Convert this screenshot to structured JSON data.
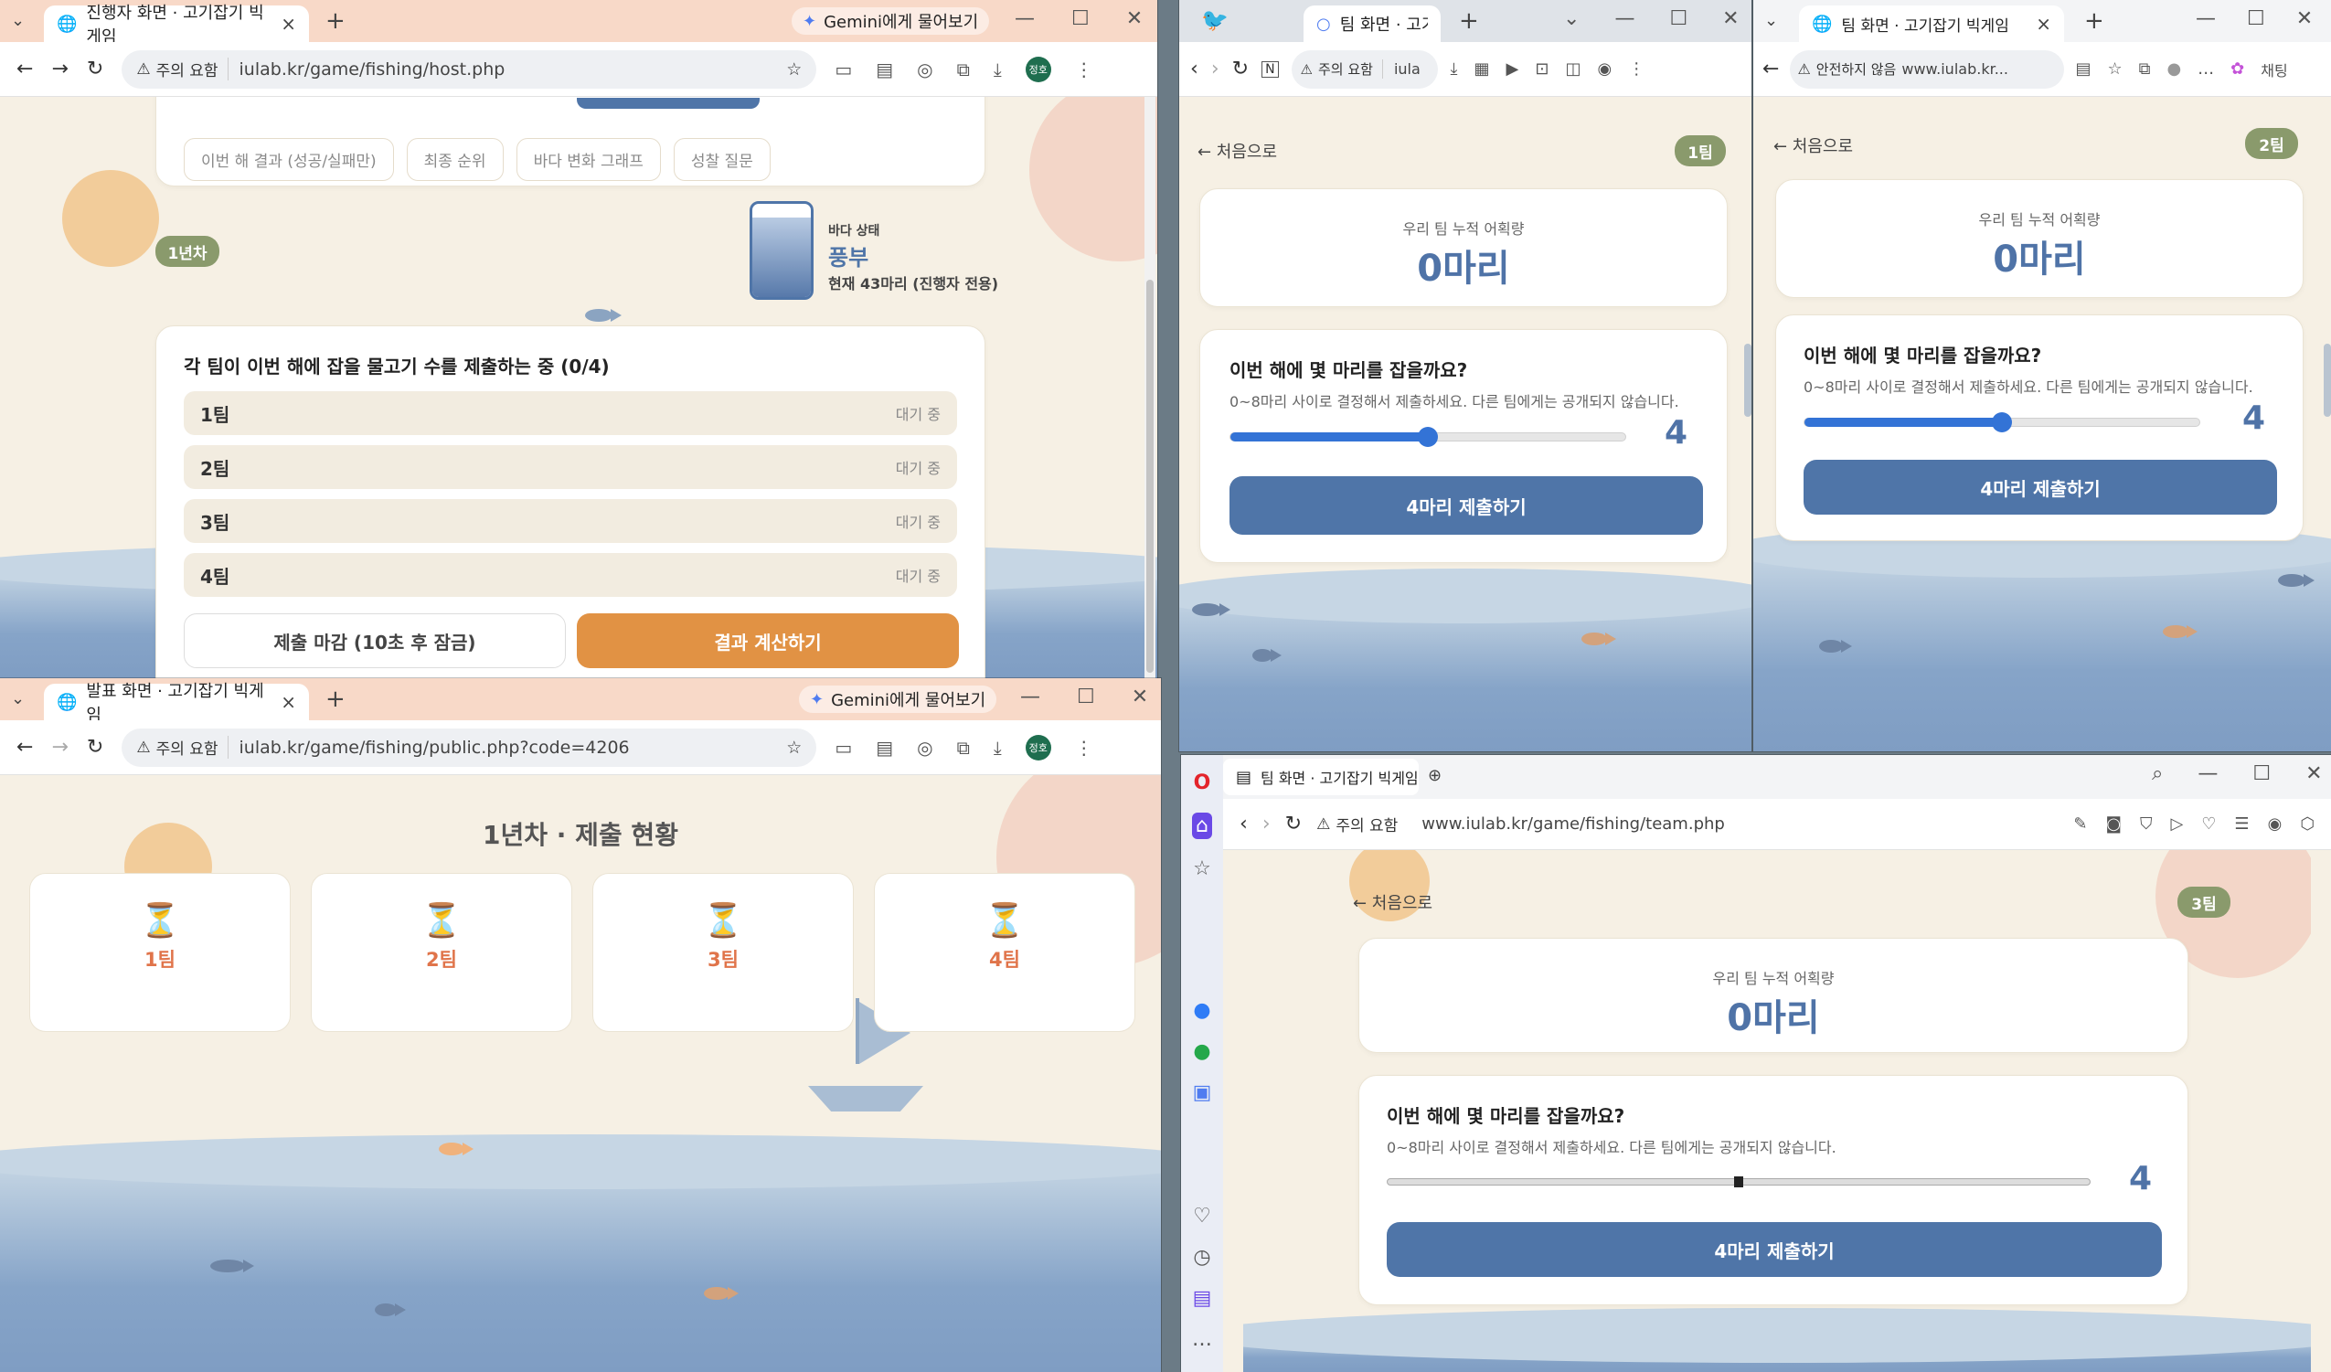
{
  "host": {
    "tab_title": "진행자 화면 · 고기잡기 빅게임",
    "gemini": "Gemini에게 물어보기",
    "warn": "주의 요함",
    "url": "iulab.kr/game/fishing/host.php",
    "avatar": "정호",
    "chips": [
      "이번 해 결과 (성공/실패만)",
      "최종 순위",
      "바다 변화 그래프",
      "성찰 질문"
    ],
    "year_badge": "1년차",
    "sea_label": "바다 상태",
    "sea_state": "풍부",
    "sea_fill_percent": 85,
    "sea_note": "현재 43마리 (진행자 전용)",
    "submission_title": "각 팀이 이번 해에 잡을 물고기 수를 제출하는 중 (0/4)",
    "teams": [
      {
        "name": "1팀",
        "status": "대기 중"
      },
      {
        "name": "2팀",
        "status": "대기 중"
      },
      {
        "name": "3팀",
        "status": "대기 중"
      },
      {
        "name": "4팀",
        "status": "대기 중"
      }
    ],
    "close_button": "제출 마감 (10초 후 잠금)",
    "calc_button": "결과 계산하기"
  },
  "public": {
    "tab_title": "발표 화면 · 고기잡기 빅게임",
    "gemini": "Gemini에게 물어보기",
    "warn": "주의 요함",
    "url": "iulab.kr/game/fishing/public.php?code=4206",
    "avatar": "정호",
    "heading": "1년차 · 제출 현황",
    "hourglass": "⏳",
    "teams": [
      "1팀",
      "2팀",
      "3팀",
      "4팀"
    ]
  },
  "team1": {
    "tab_title": "팀 화면 · 고기잡",
    "warn": "주의 요함",
    "url": "iula",
    "back": "← 처음으로",
    "badge": "1팀",
    "total_label": "우리 팀 누적 어획량",
    "total_value": "0마리",
    "question": "이번 해에 몇 마리를 잡을까요?",
    "question_sub": "0~8마리 사이로 결정해서 제출하세요. 다른 팀에게는 공개되지 않습니다.",
    "slider_value": "4",
    "slider_fraction": 0.5,
    "submit": "4마리 제출하기"
  },
  "team2": {
    "tab_title": "팀 화면 · 고기잡기 빅게임",
    "warn": "안전하지 않음",
    "url": "www.iulab.kr...",
    "bing": "채팅",
    "back": "← 처음으로",
    "badge": "2팀",
    "total_label": "우리 팀 누적 어획량",
    "total_value": "0마리",
    "question": "이번 해에 몇 마리를 잡을까요?",
    "question_sub": "0~8마리 사이로 결정해서 제출하세요. 다른 팀에게는 공개되지 않습니다.",
    "slider_value": "4",
    "slider_fraction": 0.5,
    "submit": "4마리 제출하기"
  },
  "team3": {
    "tab_title": "팀 화면 · 고기잡기 빅게임",
    "warn": "주의 요함",
    "url": "www.iulab.kr/game/fishing/team.php",
    "back": "← 처음으로",
    "badge": "3팀",
    "total_label": "우리 팀 누적 어획량",
    "total_value": "0마리",
    "question": "이번 해에 몇 마리를 잡을까요?",
    "question_sub": "0~8마리 사이로 결정해서 제출하세요. 다른 팀에게는 공개되지 않습니다.",
    "slider_value": "4",
    "slider_fraction": 0.5,
    "submit": "4마리 제출하기"
  },
  "colors": {
    "accent_blue": "#4f75a8",
    "accent_orange": "#e19244",
    "team_text": "#e0744a",
    "badge_green": "#8a9a6c"
  }
}
